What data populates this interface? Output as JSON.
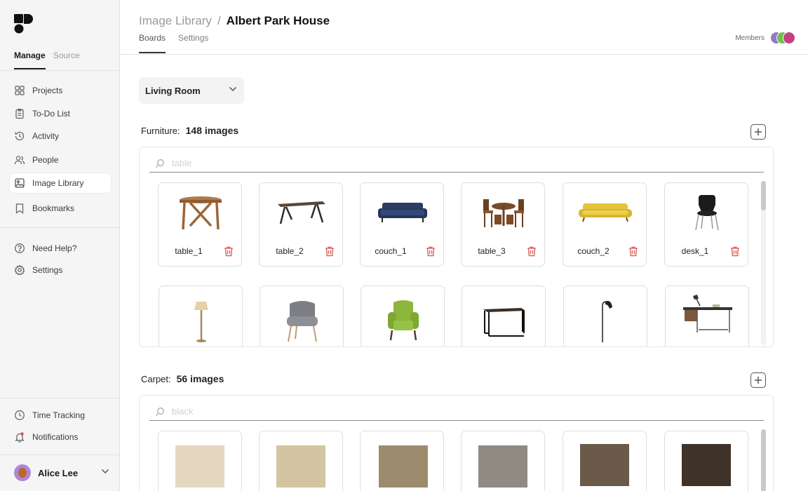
{
  "sidebar": {
    "tabs": [
      "Manage",
      "Source"
    ],
    "nav_main": [
      {
        "label": "Projects",
        "icon": "grid-icon"
      },
      {
        "label": "To-Do List",
        "icon": "clipboard-icon"
      },
      {
        "label": "Activity",
        "icon": "history-icon"
      },
      {
        "label": "People",
        "icon": "people-icon"
      },
      {
        "label": "Image Library",
        "icon": "image-icon",
        "active": true
      },
      {
        "label": "Bookmarks",
        "icon": "bookmark-icon"
      }
    ],
    "nav_help": [
      {
        "label": "Need Help?",
        "icon": "help-icon"
      },
      {
        "label": "Settings",
        "icon": "gear-icon"
      }
    ],
    "nav_bottom": [
      {
        "label": "Time Tracking",
        "icon": "clock-icon"
      },
      {
        "label": "Notifications",
        "icon": "bell-icon"
      }
    ],
    "user_name": "Alice Lee"
  },
  "header": {
    "crumb_root": "Image Library",
    "crumb_sep": "/",
    "crumb_current": "Albert Park House",
    "tabs": [
      "Boards",
      "Settings"
    ],
    "members_label": "Members"
  },
  "room_select": "Living Room",
  "sections": [
    {
      "title": "Furniture:",
      "count": "148 images",
      "search_placeholder": "table",
      "items": [
        {
          "label": "table_1",
          "icon": "round-table"
        },
        {
          "label": "table_2",
          "icon": "dining-table"
        },
        {
          "label": "couch_1",
          "icon": "navy-sofa"
        },
        {
          "label": "table_3",
          "icon": "table-with-chairs"
        },
        {
          "label": "couch_2",
          "icon": "yellow-sofa"
        },
        {
          "label": "desk_1",
          "icon": "black-chair"
        },
        {
          "label": "",
          "icon": "floor-lamp"
        },
        {
          "label": "",
          "icon": "grey-armchair"
        },
        {
          "label": "",
          "icon": "green-wingchair"
        },
        {
          "label": "",
          "icon": "black-console"
        },
        {
          "label": "",
          "icon": "arc-lamp"
        },
        {
          "label": "",
          "icon": "writing-desk"
        }
      ]
    },
    {
      "title": "Carpet:",
      "count": "56 images",
      "search_placeholder": "black",
      "items": [
        {
          "label": "",
          "color": "#e3d8bf"
        },
        {
          "label": "",
          "color": "#d3c5a1"
        },
        {
          "label": "",
          "color": "#9c8c6d"
        },
        {
          "label": "",
          "color": "#8f8a82"
        },
        {
          "label": "",
          "color": "#6b5a4a"
        },
        {
          "label": "",
          "color": "#3f3229"
        }
      ]
    }
  ],
  "colors": {
    "delete_icon": "#e0605e"
  }
}
